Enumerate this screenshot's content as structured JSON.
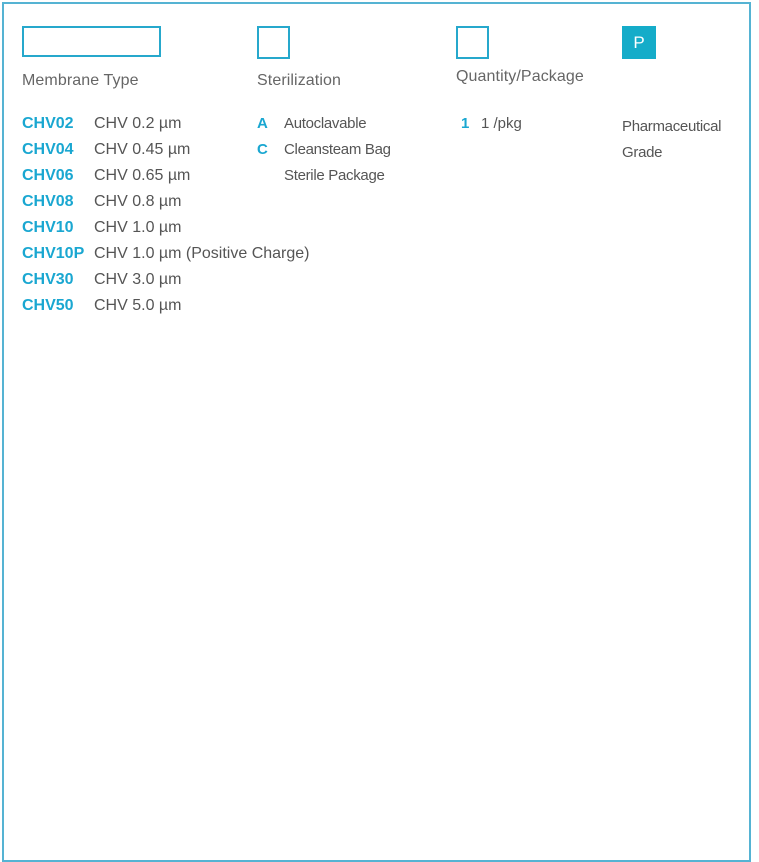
{
  "badge_label": "P",
  "columns": {
    "membrane_title": "Membrane Type",
    "sterilization_title": "Sterilization",
    "quantity_title": "Quantity/Package"
  },
  "membrane_types": [
    {
      "code": "CHV02",
      "desc": "CHV 0.2 µm"
    },
    {
      "code": "CHV04",
      "desc": "CHV 0.45 µm"
    },
    {
      "code": "CHV06",
      "desc": "CHV 0.65 µm"
    },
    {
      "code": "CHV08",
      "desc": "CHV 0.8 µm"
    },
    {
      "code": "CHV10",
      "desc": "CHV 1.0 µm"
    },
    {
      "code": "CHV10P",
      "desc": "CHV 1.0 µm (Positive Charge)"
    },
    {
      "code": "CHV30",
      "desc": "CHV 3.0 µm"
    },
    {
      "code": "CHV50",
      "desc": "CHV 5.0 µm"
    }
  ],
  "sterilization": [
    {
      "code": "A",
      "desc": "Autoclavable"
    },
    {
      "code": "C",
      "desc": "Cleansteam Bag"
    }
  ],
  "sterilization_continuation": "Sterile Package",
  "quantity": [
    {
      "code": "1",
      "desc": "1 /pkg"
    }
  ],
  "grade": {
    "line1": "Pharmaceutical",
    "line2": "Grade"
  },
  "colors": {
    "accent": "#1aa7d1",
    "border": "#55b3d3",
    "badge_bg": "#15acc9",
    "text": "#555555"
  }
}
